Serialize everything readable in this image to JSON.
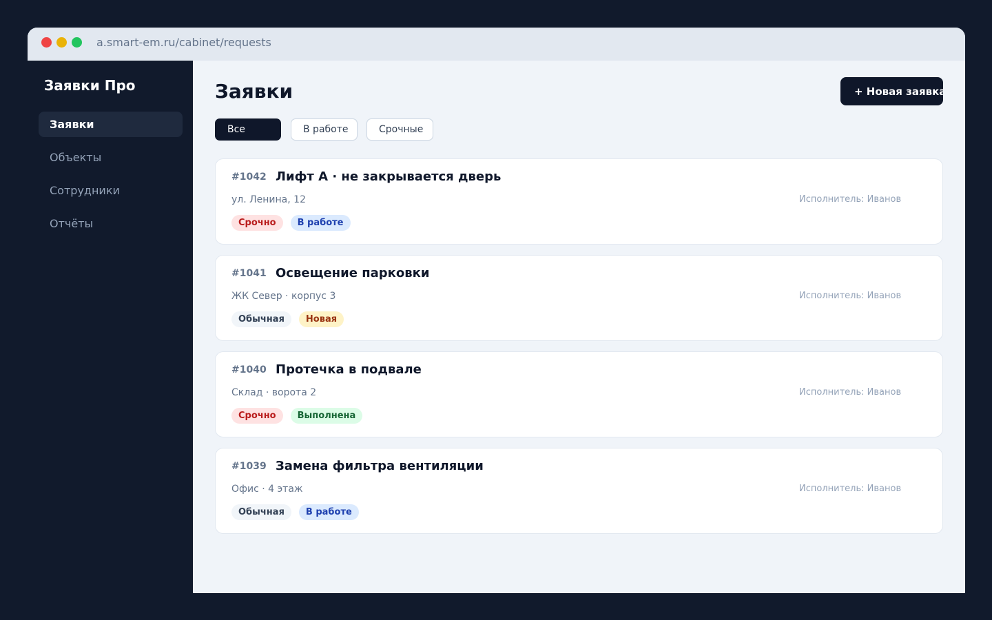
{
  "browser": {
    "url": "a.smart-em.ru/cabinet/requests"
  },
  "sidebar": {
    "brand": "Заявки Про",
    "items": [
      {
        "label": "Заявки",
        "active": true
      },
      {
        "label": "Объекты",
        "active": false
      },
      {
        "label": "Сотрудники",
        "active": false
      },
      {
        "label": "Отчёты",
        "active": false
      }
    ]
  },
  "main": {
    "title": "Заявки",
    "new_button_label": "+ Новая заявка",
    "filters": [
      {
        "label": "Все",
        "active": true
      },
      {
        "label": "В работе",
        "active": false
      },
      {
        "label": "Срочные",
        "active": false
      }
    ],
    "requests": [
      {
        "id": "#1042",
        "title": "Лифт А · не закрывается дверь",
        "address": "ул. Ленина, 12",
        "assignee": "Исполнитель: Иванов",
        "priority": "Срочно",
        "status": "В работе"
      },
      {
        "id": "#1041",
        "title": "Освещение парковки",
        "address": "ЖК Север · корпус 3",
        "assignee": "Исполнитель: Иванов",
        "priority": "Обычная",
        "status": "Новая"
      },
      {
        "id": "#1040",
        "title": "Протечка в подвале",
        "address": "Склад · ворота 2",
        "assignee": "Исполнитель: Иванов",
        "priority": "Срочно",
        "status": "Выполнена"
      },
      {
        "id": "#1039",
        "title": "Замена фильтра вентиляции",
        "address": "Офис · 4 этаж",
        "assignee": "Исполнитель: Иванов",
        "priority": "Обычная",
        "status": "В работе"
      }
    ]
  },
  "colors": {
    "background": "#111a2c",
    "accent": "#0f172a",
    "urgent_bg": "#fee2e2",
    "urgent_text": "#b91c1c",
    "in_work_bg": "#dbeafe",
    "in_work_text": "#1e40af",
    "new_bg": "#fef3c7",
    "new_text": "#9a3412",
    "done_bg": "#dcfce7",
    "done_text": "#166534"
  }
}
